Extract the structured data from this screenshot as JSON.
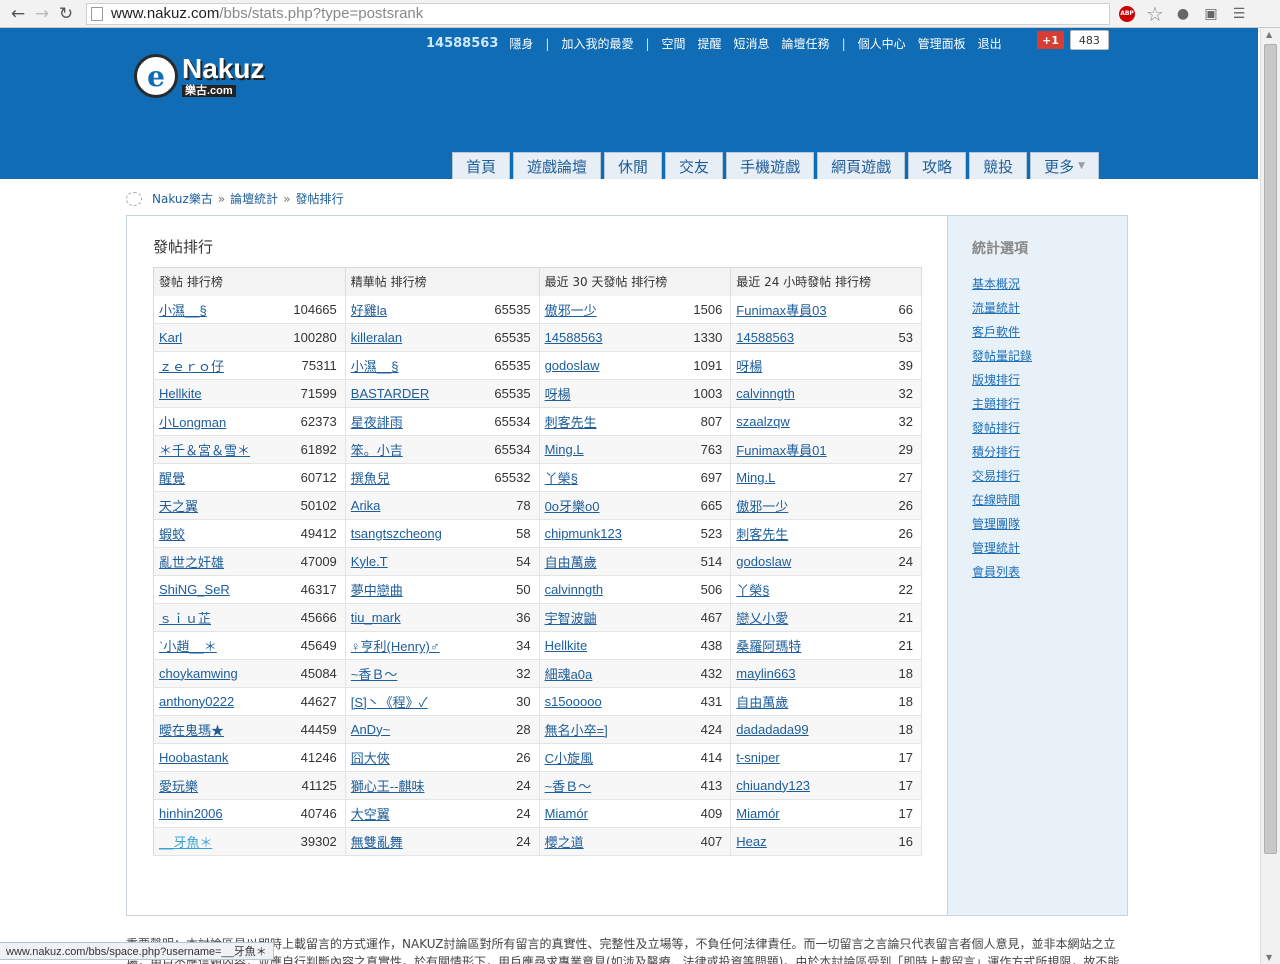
{
  "browser": {
    "url_host": "www.nakuz.com",
    "url_path": "/bbs/stats.php?type=postsrank",
    "abp_label": "ABP"
  },
  "header": {
    "logo_text": "Nakuz",
    "logo_sub": "樂古.com",
    "uid": "14588563",
    "links": [
      "隱身",
      "加入我的最愛",
      "空間",
      "提醒",
      "短消息",
      "論壇任務",
      "個人中心",
      "管理面板",
      "退出"
    ],
    "gplus_label": "+1",
    "gplus_count": "483"
  },
  "nav": {
    "tabs": [
      "首頁",
      "遊戲論壇",
      "休閒",
      "交友",
      "手機遊戲",
      "網頁遊戲",
      "攻略",
      "競投",
      "更多"
    ]
  },
  "breadcrumb": [
    "Nakuz樂古",
    "論壇統計",
    "發帖排行"
  ],
  "main": {
    "title": "發帖排行",
    "columns": [
      "發帖 排行榜",
      "精華帖 排行榜",
      "最近 30 天發帖 排行榜",
      "最近 24 小時發帖 排行榜"
    ],
    "rows": [
      [
        [
          "小濕__§",
          "104665"
        ],
        [
          "好雞la",
          "65535"
        ],
        [
          "傲邪一少",
          "1506"
        ],
        [
          "Funimax專員03",
          "66"
        ]
      ],
      [
        [
          "Karl",
          "100280"
        ],
        [
          "killeralan",
          "65535"
        ],
        [
          "14588563",
          "1330"
        ],
        [
          "14588563",
          "53"
        ]
      ],
      [
        [
          "ｚｅｒｏ仔",
          "75311"
        ],
        [
          "小濕__§",
          "65535"
        ],
        [
          "godoslaw",
          "1091"
        ],
        [
          "呀楊",
          "39"
        ]
      ],
      [
        [
          "Hellkite",
          "71599"
        ],
        [
          "BASTARDER",
          "65535"
        ],
        [
          "呀楊",
          "1003"
        ],
        [
          "calvinngth",
          "32"
        ]
      ],
      [
        [
          "小Longman",
          "62373"
        ],
        [
          "星夜誹雨",
          "65534"
        ],
        [
          "刺客先生",
          "807"
        ],
        [
          "szaalzqw",
          "32"
        ]
      ],
      [
        [
          "＊千＆宮＆雪＊",
          "61892"
        ],
        [
          "笨。小吉",
          "65534"
        ],
        [
          "Ming.L",
          "763"
        ],
        [
          "Funimax專員01",
          "29"
        ]
      ],
      [
        [
          "醒覺",
          "60712"
        ],
        [
          "撰魚兒",
          "65532"
        ],
        [
          "丫榮§",
          "697"
        ],
        [
          "Ming.L",
          "27"
        ]
      ],
      [
        [
          "天之翼",
          "50102"
        ],
        [
          "Arika",
          "78"
        ],
        [
          "0o牙樂o0",
          "665"
        ],
        [
          "傲邪一少",
          "26"
        ]
      ],
      [
        [
          "蝦蛟",
          "49412"
        ],
        [
          "tsangtszcheong",
          "58"
        ],
        [
          "chipmunk123",
          "523"
        ],
        [
          "刺客先生",
          "26"
        ]
      ],
      [
        [
          "亂世之奸雄",
          "47009"
        ],
        [
          "Kyle.T",
          "54"
        ],
        [
          "自由萬歲",
          "514"
        ],
        [
          "godoslaw",
          "24"
        ]
      ],
      [
        [
          "ShiNG_SeR",
          "46317"
        ],
        [
          "夢中戀曲",
          "50"
        ],
        [
          "calvinngth",
          "506"
        ],
        [
          "丫榮§",
          "22"
        ]
      ],
      [
        [
          "ｓｉｕ芷",
          "45666"
        ],
        [
          "tiu_mark",
          "36"
        ],
        [
          "宇智波鼬",
          "467"
        ],
        [
          "戀乂小愛",
          "21"
        ]
      ],
      [
        [
          "ˋ小趙__＊",
          "45649"
        ],
        [
          "♀亨利(Henry)♂",
          "34"
        ],
        [
          "Hellkite",
          "438"
        ],
        [
          "桑羅阿瑪特",
          "21"
        ]
      ],
      [
        [
          "choykamwing",
          "45084"
        ],
        [
          "~香Ｂ～",
          "32"
        ],
        [
          "細魂a0a",
          "432"
        ],
        [
          "maylin663",
          "18"
        ]
      ],
      [
        [
          "anthony0222",
          "44627"
        ],
        [
          "[S]丶《程》✓",
          "30"
        ],
        [
          "s15ooooo",
          "431"
        ],
        [
          "自由萬歲",
          "18"
        ]
      ],
      [
        [
          "曖在鬼瑪★",
          "44459"
        ],
        [
          "AnDy~",
          "28"
        ],
        [
          "無名小卒=]",
          "424"
        ],
        [
          "dadadada99",
          "18"
        ]
      ],
      [
        [
          "Hoobastank",
          "41246"
        ],
        [
          "囧大俠",
          "26"
        ],
        [
          "C小旋風",
          "414"
        ],
        [
          "t-sniper",
          "17"
        ]
      ],
      [
        [
          "愛玩樂",
          "41125"
        ],
        [
          "獅心王--麒味",
          "24"
        ],
        [
          "~香Ｂ～",
          "413"
        ],
        [
          "chiuandy123",
          "17"
        ]
      ],
      [
        [
          "hinhin2006",
          "40746"
        ],
        [
          "大空翼",
          "24"
        ],
        [
          "Miamór",
          "409"
        ],
        [
          "Miamór",
          "17"
        ]
      ],
      [
        [
          "__牙魚＊",
          "39302"
        ],
        [
          "無雙亂舞",
          "24"
        ],
        [
          "櫻之道",
          "407"
        ],
        [
          "Heaz",
          "16"
        ]
      ]
    ]
  },
  "sidebar": {
    "title": "統計選項",
    "items": [
      "基本概況",
      "流量統計",
      "客戶軟件",
      "發帖量記錄",
      "版塊排行",
      "主題排行",
      "發帖排行",
      "積分排行",
      "交易排行",
      "在線時間",
      "管理團隊",
      "管理統計",
      "會員列表"
    ]
  },
  "disclaimer": {
    "line1": "重要聲明：本討論區是以即時上載留言的方式運作，NAKUZ討論區對所有留言的真實性、完整性及立場等，不負任何法律責任。而一切留言之言論只代表留言者個人意見，並非本網站之立",
    "line2": "場，用戶不應信賴內容，並應自行判斷內容之真實性。於有關情形下，用戶應尋求專業意見(如涉及醫療、法律或投資等問題)。由於本討論區受到「即時上載留言」運作方式所規限，故不能"
  },
  "statusbar": {
    "text": "www.nakuz.com/bbs/space.php?username=__牙魚＊"
  }
}
